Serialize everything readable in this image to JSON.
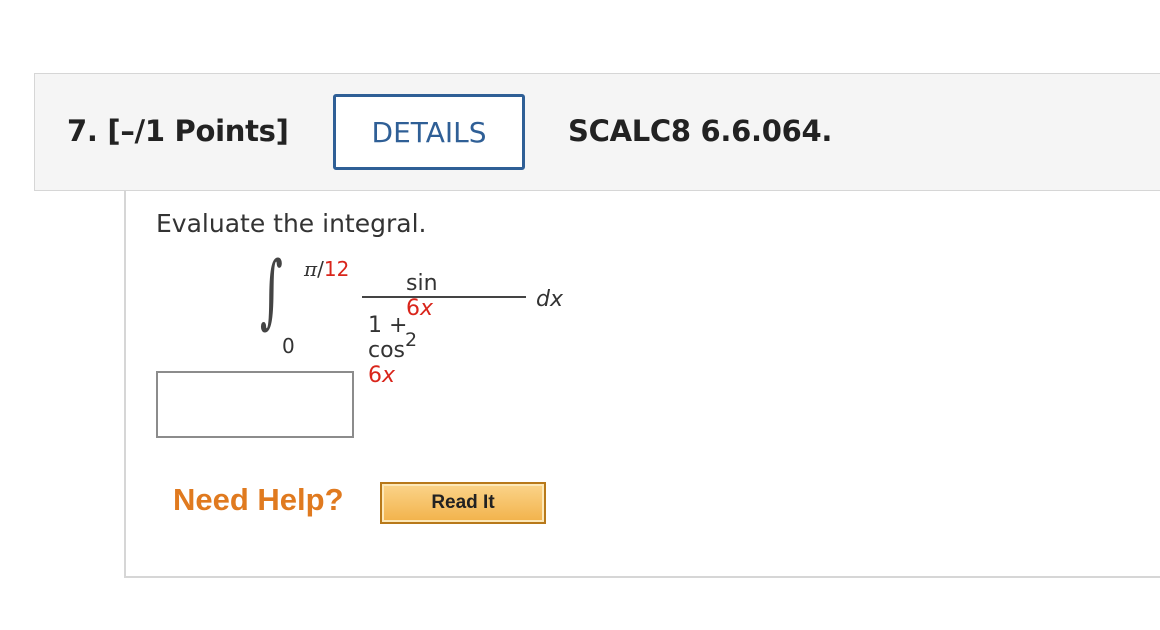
{
  "header": {
    "question_number": "7.",
    "points": "[–/1 Points]",
    "details_label": "DETAILS",
    "problem_code": "SCALC8 6.6.064."
  },
  "question": {
    "prompt": "Evaluate the integral.",
    "integral": {
      "upper_limit_symbol": "π",
      "upper_limit_slash": "/",
      "upper_limit_value": "12",
      "lower_limit": "0",
      "numerator_func": "sin",
      "numerator_arg_coef": "6",
      "numerator_arg_var": "x",
      "denominator_const": "1 + cos",
      "denominator_power": "2",
      "denominator_arg_coef": "6",
      "denominator_arg_var": "x",
      "differential": "dx"
    },
    "answer": {
      "value": "",
      "placeholder": ""
    }
  },
  "help": {
    "need_help_label": "Need Help?",
    "read_it_label": "Read It"
  },
  "colors": {
    "accent_blue": "#2f5f96",
    "variable_red": "#d9251b",
    "help_orange": "#e07a1f",
    "button_gold": "#f2b24a"
  }
}
